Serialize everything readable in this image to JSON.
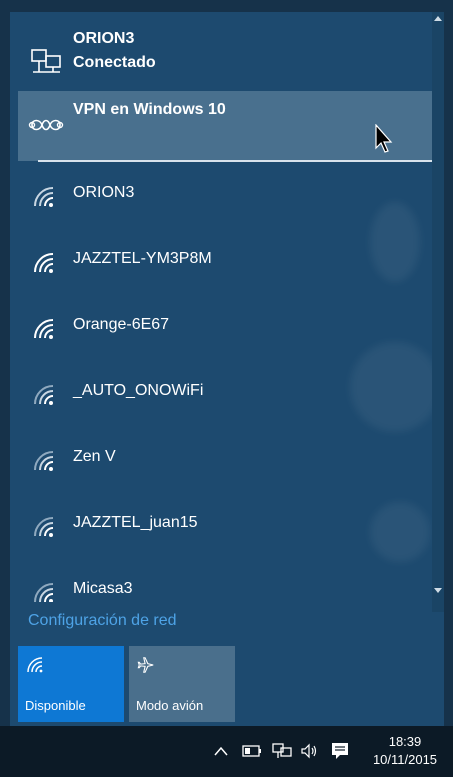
{
  "connected": {
    "name": "ORION3",
    "status": "Conectado",
    "icon": "ethernet-icon"
  },
  "vpn": {
    "label": "VPN en Windows 10",
    "icon": "vpn-icon"
  },
  "networks": [
    {
      "ssid": "ORION3",
      "icon": "wifi-icon"
    },
    {
      "ssid": "JAZZTEL-YM3P8M",
      "icon": "wifi-icon"
    },
    {
      "ssid": "Orange-6E67",
      "icon": "wifi-icon"
    },
    {
      "ssid": "_AUTO_ONOWiFi",
      "icon": "wifi-icon"
    },
    {
      "ssid": "Zen V",
      "icon": "wifi-icon"
    },
    {
      "ssid": "JAZZTEL_juan15",
      "icon": "wifi-icon"
    },
    {
      "ssid": "Micasa3",
      "icon": "wifi-icon"
    }
  ],
  "network_settings_link": "Configuración de red",
  "tiles": {
    "wifi": {
      "label": "Disponible",
      "icon": "wifi-icon",
      "color": "#0e78d4"
    },
    "airplane": {
      "label": "Modo avión",
      "icon": "airplane-icon",
      "color": "#4a6f8c"
    }
  },
  "taskbar": {
    "time": "18:39",
    "date": "10/11/2015"
  },
  "colors": {
    "flyout_bg": "#1d4a6f",
    "accent": "#0e78d4",
    "link": "#4ea3e6",
    "vpn_highlight": "#49708e"
  }
}
